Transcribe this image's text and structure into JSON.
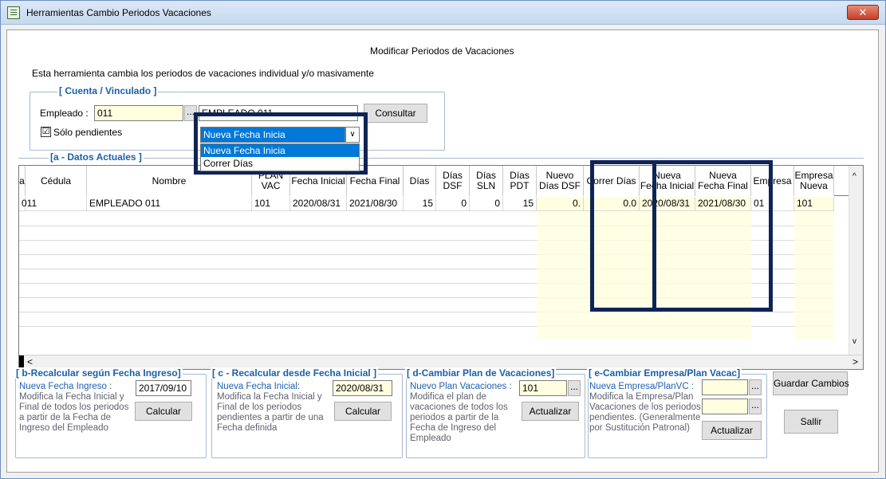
{
  "window": {
    "title": "Herramientas Cambio Periodos Vacaciones",
    "close_label": "✕"
  },
  "header": {
    "title": "Modificar Periodos de Vacaciones",
    "description": "Esta herramienta cambia los periodos de vacaciones individual y/o masivamente"
  },
  "cuenta": {
    "title": "[ Cuenta / Vinculado ]",
    "employee_label": "Empleado :",
    "employee_code": "011",
    "browse_label": "...",
    "employee_name": "EMPLEADO 011",
    "consult_label": "Consultar",
    "only_pending_label": "Sólo pendientes",
    "only_pending_checked": "☑"
  },
  "dropdown": {
    "selected": "Nueva Fecha Inicia",
    "options": [
      "Nueva Fecha Inicia",
      "Correr Días"
    ]
  },
  "datos": {
    "title": "[a - Datos Actuales ]"
  },
  "grid": {
    "columns": [
      {
        "label": "a"
      },
      {
        "label": "Cédula"
      },
      {
        "label": "Nombre"
      },
      {
        "label": "PLAN VAC"
      },
      {
        "label": "Fecha Inicial"
      },
      {
        "label": "Fecha Final"
      },
      {
        "label": "Días"
      },
      {
        "label": "Días DSF"
      },
      {
        "label": "Días SLN"
      },
      {
        "label": "Días PDT"
      },
      {
        "label": "Nuevo Días DSF"
      },
      {
        "label": "Correr Días"
      },
      {
        "label": "Nueva Fecha Inicial"
      },
      {
        "label": "Nueva Fecha Final"
      },
      {
        "label": "Empresa"
      },
      {
        "label": "Empresa Nueva"
      }
    ],
    "rows": [
      [
        "",
        "011",
        "EMPLEADO 011",
        "101",
        "2020/08/31",
        "2021/08/30",
        "15",
        "0",
        "0",
        "15",
        "0.",
        "0.0",
        "2020/08/31",
        "2021/08/30",
        "01",
        "101"
      ]
    ]
  },
  "b": {
    "title": "[ b-Recalcular según Fecha Ingreso]",
    "desc_head": "Nueva Fecha Ingreso :",
    "desc": "Modifica la Fecha Inicial y Final de todos los periodos a partir de la Fecha de Ingreso del Empleado",
    "value": "2017/09/10",
    "button": "Calcular"
  },
  "c": {
    "title": "[ c - Recalcular desde Fecha Inicial ]",
    "desc_head": "Nueva Fecha Inicial:",
    "desc": "Modifica la Fecha Inicial y Final de los periodos pendientes a partir de una Fecha definida",
    "value": "2020/08/31",
    "button": "Calcular"
  },
  "d": {
    "title": "[ d-Cambiar Plan de Vacaciones]",
    "desc_head": "Nuevo Plan Vacaciones :",
    "desc": "Modifica el plan de vacaciones de todos los periodos a partir de la Fecha de Ingreso del Empleado",
    "value": "101",
    "browse": "...",
    "button": "Actualizar"
  },
  "e": {
    "title": "[ e-Cambiar Empresa/Plan Vacac]",
    "desc_head": "Nueva Empresa/PlanVC :",
    "desc": "Modifica la Empresa/Plan Vacaciones de los periodos pendientes. (Generalmente por Sustitución Patronal)",
    "value1": "",
    "value2": "",
    "browse": "...",
    "button": "Actualizar"
  },
  "actions": {
    "save": "Guardar Cambios",
    "exit": "Sallir"
  },
  "scroll": {
    "left": "<",
    "right": ">",
    "up": "^",
    "down": "v"
  },
  "colors": {
    "highlight": "#0f2456",
    "accent": "#1a5fa8",
    "editable": "#ffffe0",
    "selection": "#0078d7"
  }
}
